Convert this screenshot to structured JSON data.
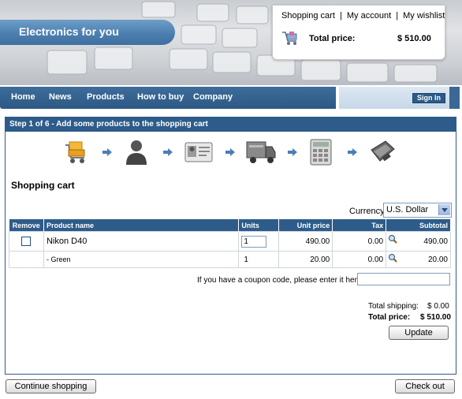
{
  "header": {
    "logo_text": "Electronics for you",
    "links": [
      "Shopping cart",
      "My account",
      "My wishlist"
    ],
    "link_separator": "|",
    "total_price_label": "Total price:",
    "total_price_value": "$ 510.00"
  },
  "nav": {
    "items": [
      "Home",
      "News",
      "Products",
      "How to buy",
      "Company"
    ],
    "sign_in": "Sign In"
  },
  "wizard": {
    "step_text": "Step 1 of 6 - Add some products to the shopping cart",
    "step_icons": [
      "cart-icon",
      "user-icon",
      "id-card-icon",
      "truck-icon",
      "calculator-icon",
      "wallet-icon"
    ]
  },
  "cart": {
    "title": "Shopping cart",
    "currency_label": "Currency:",
    "currency_value": "U.S. Dollar",
    "columns": [
      "Remove",
      "Product name",
      "Units",
      "Unit price",
      "Tax",
      "Subtotal"
    ],
    "rows": [
      {
        "product": "Nikon D40",
        "units": "1",
        "unit_price": "490.00",
        "tax": "0.00",
        "subtotal": "490.00"
      },
      {
        "product": "- Green",
        "units": "1",
        "unit_price": "20.00",
        "tax": "0.00",
        "subtotal": "20.00"
      }
    ],
    "coupon_label": "If you have a coupon code, please enter it here:",
    "shipping_label": "Total shipping:",
    "shipping_value": "$ 0.00",
    "total_label": "Total price:",
    "total_value": "$ 510.00",
    "update_label": "Update"
  },
  "footer": {
    "continue_label": "Continue shopping",
    "checkout_label": "Check out"
  },
  "colors": {
    "brand_blue": "#2d5c8a",
    "logo_band": "#4c7fb0",
    "signin_area": "#c6d8e8"
  }
}
